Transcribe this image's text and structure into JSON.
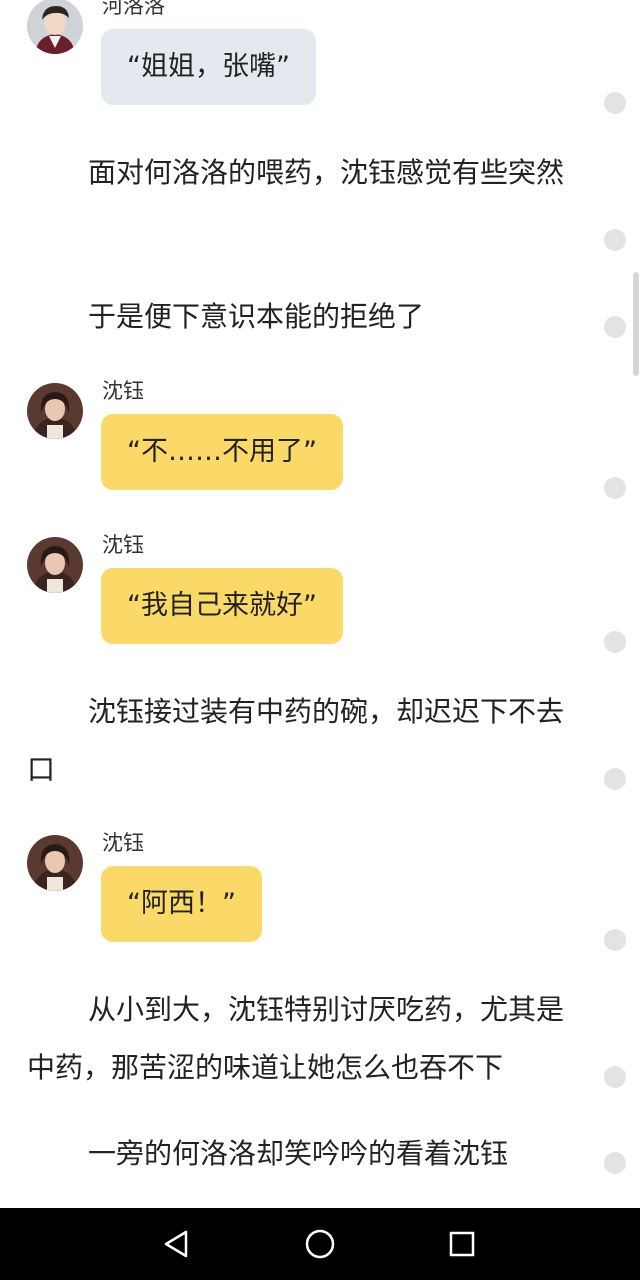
{
  "story": {
    "items": [
      {
        "kind": "dialogue",
        "speaker": "河洛洛",
        "text": "“姐姐，张嘴”",
        "bubble_color": "#e4e9f0",
        "avatar_icon": "boy-portrait-icon"
      },
      {
        "kind": "narration",
        "text": "面对何洛洛的喂药，沈钰感觉有些突然"
      },
      {
        "kind": "narration",
        "text": "于是便下意识本能的拒绝了"
      },
      {
        "kind": "dialogue",
        "speaker": "沈钰",
        "text": "“不……不用了”",
        "bubble_color": "#fbd968",
        "avatar_icon": "girl-portrait-icon"
      },
      {
        "kind": "dialogue",
        "speaker": "沈钰",
        "text": "“我自己来就好”",
        "bubble_color": "#fbd968",
        "avatar_icon": "girl-portrait-icon"
      },
      {
        "kind": "narration",
        "text": "沈钰接过装有中药的碗，却迟迟下不去口"
      },
      {
        "kind": "dialogue",
        "speaker": "沈钰",
        "text": "“阿西！”",
        "bubble_color": "#fbd968",
        "avatar_icon": "girl-portrait-icon"
      },
      {
        "kind": "narration",
        "text": "从小到大，沈钰特别讨厌吃药，尤其是中药，那苦涩的味道让她怎么也吞不下"
      },
      {
        "kind": "narration",
        "text": "一旁的何洛洛却笑吟吟的看着沈钰"
      }
    ]
  },
  "nav_bar": {
    "buttons": [
      {
        "icon": "back-triangle-icon"
      },
      {
        "icon": "home-circle-icon"
      },
      {
        "icon": "recents-square-icon"
      }
    ]
  }
}
